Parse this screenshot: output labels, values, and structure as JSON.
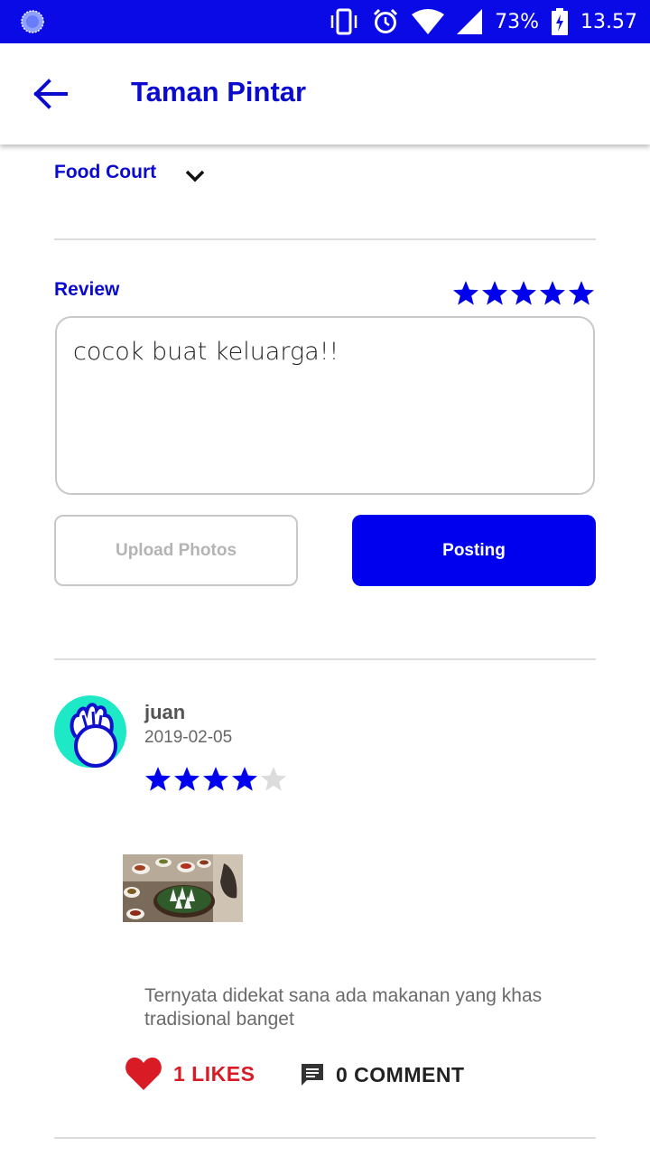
{
  "status_bar": {
    "battery": "73%",
    "time": "13.57",
    "icons": [
      "data-saver-icon",
      "vibrate-icon",
      "alarm-icon",
      "wifi-icon",
      "signal-icon",
      "battery-charging-icon"
    ]
  },
  "app_bar": {
    "title": "Taman Pintar",
    "back_icon": "arrow-back-icon"
  },
  "category": {
    "selected": "Food Court",
    "icon": "chevron-down-icon"
  },
  "review_form": {
    "label": "Review",
    "rating": 5,
    "rating_max": 5,
    "text": "cocok buat keluarga!!",
    "upload_label": "Upload Photos",
    "post_label": "Posting"
  },
  "post": {
    "user": "juan",
    "date": "2019-02-05",
    "rating": 4,
    "rating_max": 5,
    "text": "Ternyata didekat sana ada makanan yang khas tradisional banget",
    "likes_label": "1 LIKES",
    "comments_label": "0 COMMENT"
  },
  "colors": {
    "primary": "#0000ee",
    "title_blue": "#0b0bcf",
    "like_red": "#d81b25",
    "star_empty": "#dcdcdc",
    "avatar_bg": "#1de9c7"
  }
}
